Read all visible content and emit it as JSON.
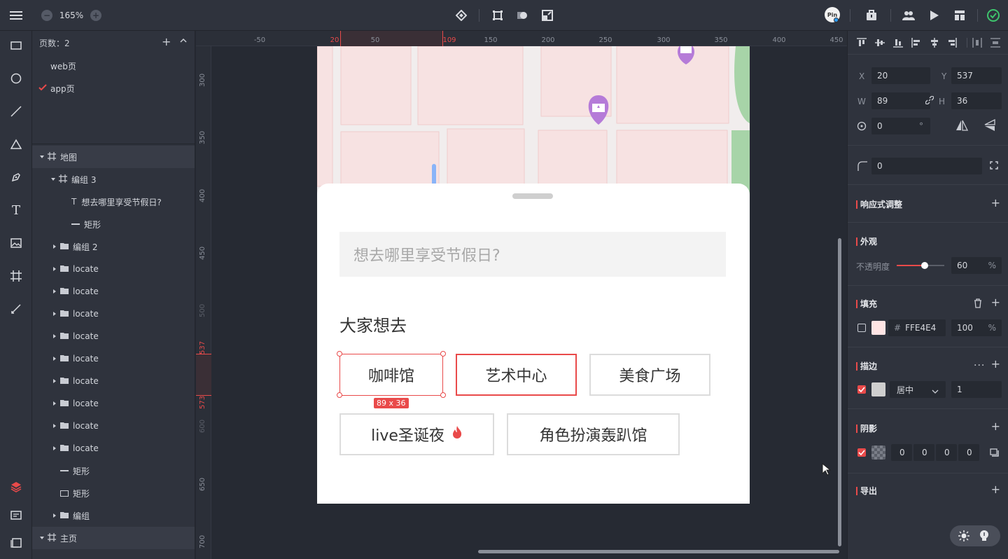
{
  "topbar": {
    "zoom": "165%",
    "avatar_text": "Pin"
  },
  "layers": {
    "page_count": "页数：2",
    "pages": [
      {
        "label": "web页",
        "checked": false
      },
      {
        "label": "app页",
        "checked": true
      }
    ],
    "artboards": [
      {
        "label": "地图"
      },
      {
        "label": "编组 3"
      },
      {
        "label": "想去哪里享受节假日?"
      },
      {
        "label": "矩形"
      },
      {
        "label": "编组 2"
      },
      {
        "label": "locate"
      },
      {
        "label": "locate"
      },
      {
        "label": "locate"
      },
      {
        "label": "locate"
      },
      {
        "label": "locate"
      },
      {
        "label": "locate"
      },
      {
        "label": "locate"
      },
      {
        "label": "locate"
      },
      {
        "label": "locate"
      },
      {
        "label": "矩形"
      },
      {
        "label": "矩形"
      },
      {
        "label": "编组"
      },
      {
        "label": "主页"
      }
    ]
  },
  "ruler": {
    "h_ticks": [
      "-50",
      "20",
      "50",
      "109",
      "150",
      "200",
      "250",
      "300",
      "350",
      "400",
      "450"
    ],
    "v_ticks": [
      "300",
      "350",
      "400",
      "450",
      "500",
      "537",
      "573",
      "600",
      "650",
      "700"
    ]
  },
  "canvas": {
    "search_placeholder": "想去哪里享受节假日?",
    "section_title": "大家想去",
    "chips": [
      "咖啡馆",
      "艺术中心",
      "美食广场",
      "live圣诞夜",
      "角色扮演轰趴馆"
    ],
    "selection_size": "89 x 36"
  },
  "props": {
    "x_label": "X",
    "x": "20",
    "y_label": "Y",
    "y": "537",
    "w_label": "W",
    "w": "89",
    "h_label": "H",
    "h": "36",
    "rotation": "0",
    "rotation_unit": "°",
    "radius": "0",
    "responsive": "响应式调整",
    "appearance": "外观",
    "opacity_label": "不透明度",
    "opacity": "60",
    "percent": "%",
    "fill": "填充",
    "fill_hex_prefix": "#",
    "fill_color": "FFE4E4",
    "fill_opacity": "100",
    "stroke": "描边",
    "stroke_align": "居中",
    "stroke_width": "1",
    "shadow": "阴影",
    "shadow_values": [
      "0",
      "0",
      "0",
      "0"
    ],
    "export": "导出"
  },
  "colors": {
    "accent": "#e94a4a",
    "success": "#3ec46d",
    "fill_swatch": "#ffe4e4",
    "map_pin": "#b57bd8"
  }
}
